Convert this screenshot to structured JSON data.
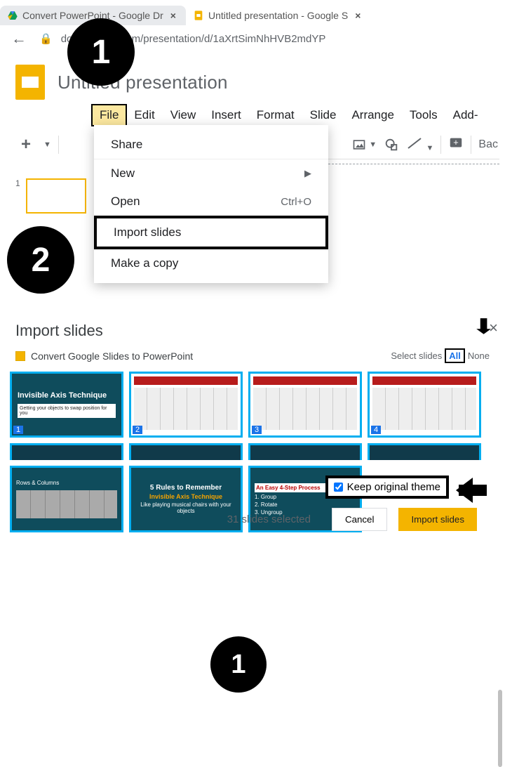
{
  "tabs": {
    "a": {
      "label": "Convert PowerPoint - Google Dr"
    },
    "b": {
      "label": "Untitled presentation - Google S"
    }
  },
  "url": "docs.google.com/presentation/d/1aXrtSimNhHVB2mdYP",
  "doc_title": "Untitled presentation",
  "menubar": {
    "file": "File",
    "edit": "Edit",
    "view": "View",
    "insert": "Insert",
    "format": "Format",
    "slide": "Slide",
    "arrange": "Arrange",
    "tools": "Tools",
    "addons": "Add-"
  },
  "toolbar": {
    "plus": "+",
    "back_label": "Bac"
  },
  "thumb_number": "1",
  "file_menu": {
    "share": "Share",
    "new": "New",
    "open": "Open",
    "open_kbd": "Ctrl+O",
    "import": "Import slides",
    "copy": "Make a copy"
  },
  "step1": "1",
  "step2": "2",
  "step1b": "1",
  "import_dialog": {
    "heading": "Import slides",
    "source_title": "Convert Google Slides to PowerPoint",
    "select_label": "Select slides",
    "select_all": "All",
    "select_none": "None",
    "keep_theme": "Keep original theme",
    "count": "31 slides selected",
    "cancel": "Cancel",
    "import_btn": "Import slides"
  },
  "sample_slides": {
    "s1_title": "Invisible Axis Technique",
    "s1_sub": "Getting your objects to swap position for you",
    "s5": "Rows & Columns",
    "s6_title": "5 Rules to Remember",
    "s6_sub": "Invisible Axis Technique",
    "s6_line": "Like playing musical chairs with your objects",
    "s7_title": "An Easy 4-Step Process",
    "s7_1": "1. Group",
    "s7_2": "2. Rotate",
    "s7_3": "3. Ungroup"
  }
}
